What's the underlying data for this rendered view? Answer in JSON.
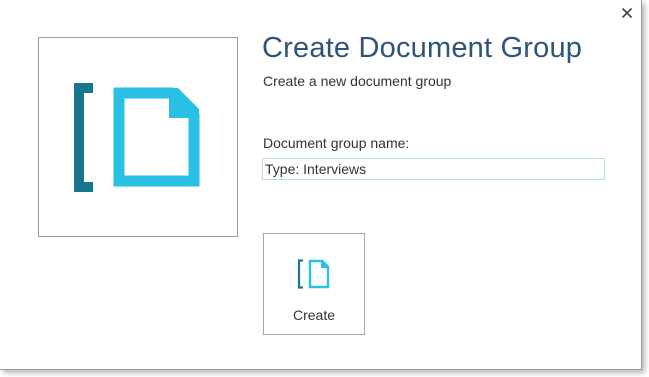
{
  "dialog": {
    "title": "Create Document Group",
    "subtitle": "Create a new document group",
    "close_icon": "close-icon",
    "logo_icon": "document-group-icon"
  },
  "form": {
    "name_label": "Document group name:",
    "name_value": "Type: Interviews"
  },
  "actions": {
    "create_label": "Create",
    "create_icon": "document-group-icon"
  },
  "colors": {
    "bracket": "#17778f",
    "document": "#29c0e4",
    "title": "#2e5479",
    "input_border": "#b9dcea"
  }
}
